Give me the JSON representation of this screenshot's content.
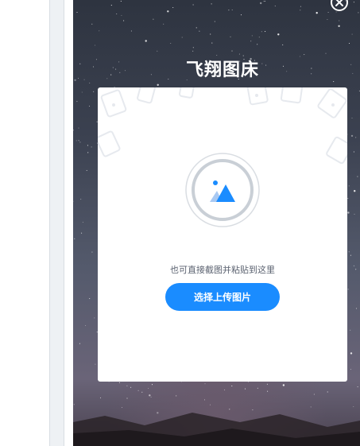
{
  "app": {
    "title": "飞翔图床"
  },
  "upload": {
    "hint": "也可直接截图并粘贴到这里",
    "button_label": "选择上传图片"
  },
  "colors": {
    "accent": "#1a8cff",
    "card_bg": "#ffffff",
    "title_text": "#ffffff",
    "hint_text": "#5b6270"
  },
  "icons": {
    "close": "close-circle-icon",
    "upload": "image-upload-icon"
  }
}
